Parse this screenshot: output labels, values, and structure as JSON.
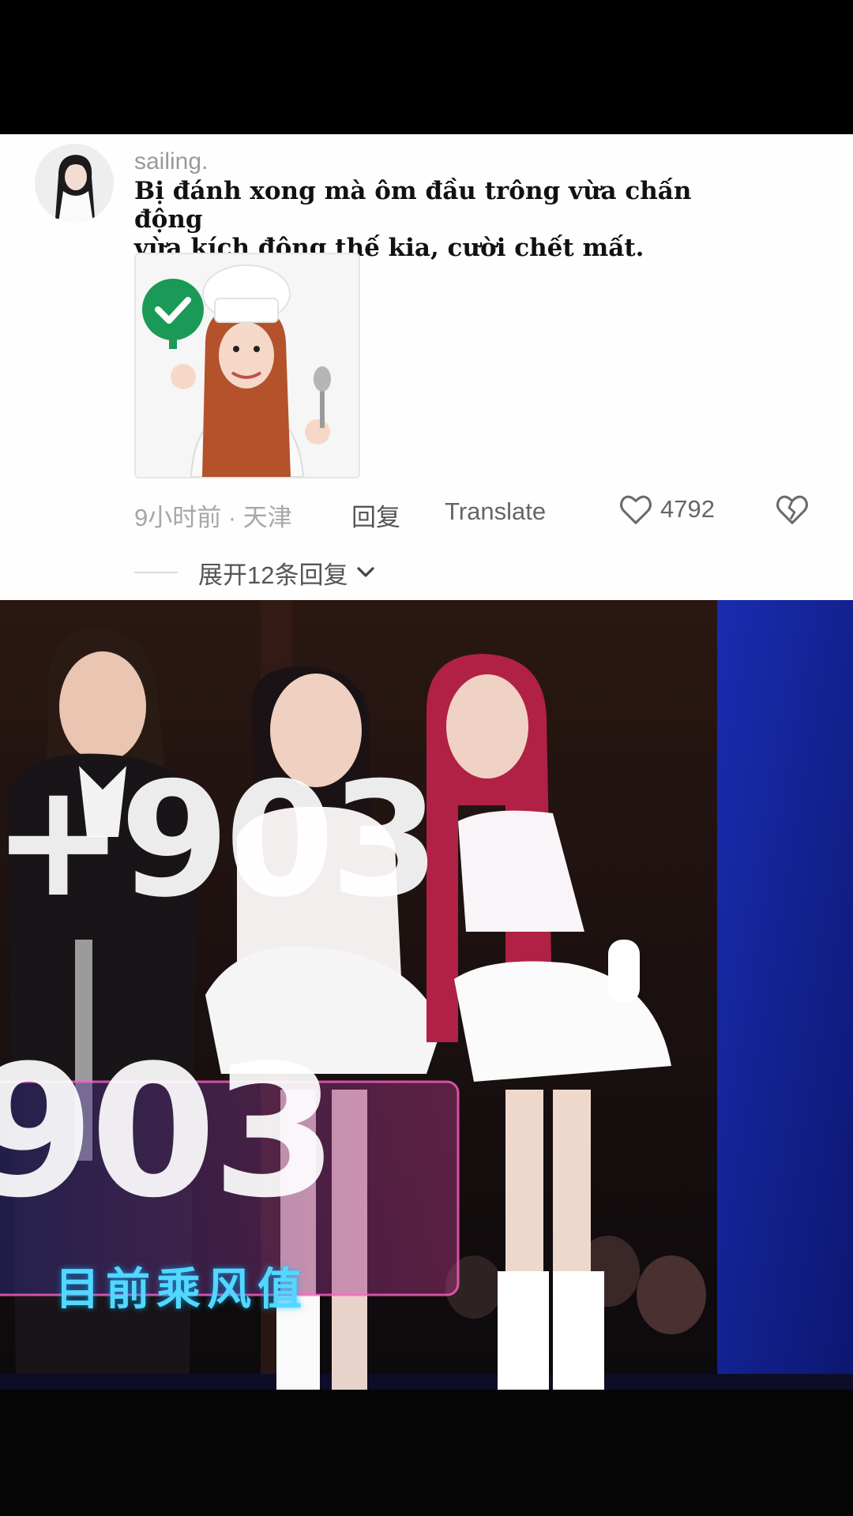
{
  "comment": {
    "username": "sailing.",
    "text_line1": "Bị đánh xong mà ôm đầu trông vừa chấn động",
    "text_line2": "vừa kích động thế kia, cười chết mất.",
    "time_location": "9小时前 · 天津",
    "reply_label": "回复",
    "translate_label": "Translate",
    "like_count": "4792",
    "expand_replies_label": "展开12条回复"
  },
  "icons": {
    "like": "heart-outline-icon",
    "dislike": "broken-heart-icon",
    "expand": "chevron-down-icon",
    "sticker_check": "check-sign-icon"
  },
  "video": {
    "overlay_score_top": "+903",
    "overlay_score_bottom": "903",
    "overlay_label": "目前乘风值"
  },
  "colors": {
    "card_background": "#fefefe",
    "username": "#9a9a9a",
    "meta_text": "#a7a7a7",
    "check_green": "#1a9a56",
    "overlay_label": "#53d7ff",
    "stage_blue": "#1b2aa6"
  }
}
